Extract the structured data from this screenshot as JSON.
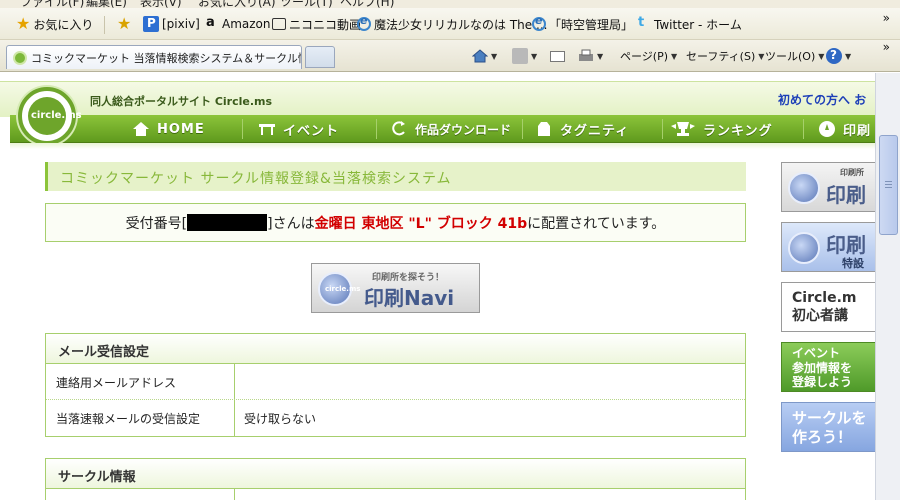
{
  "menubar": {
    "items": [
      "ファイル(F)",
      "編集(E)",
      "表示(V)",
      "お気に入り(A)",
      "ツール(T)",
      "ヘルプ(H)"
    ]
  },
  "favorites_bar": {
    "favorites_label": "お気に入り",
    "links": [
      "[pixiv]",
      "Amazon",
      "ニコニコ動画",
      "魔法少女リリカルなのは The ...",
      "「時空管理局」",
      "Twitter - ホーム"
    ],
    "overflow": "»"
  },
  "tabs": {
    "active_title": "コミックマーケット 当落情報検索システム＆サークル情...",
    "overflow": "»"
  },
  "command_bar": {
    "page_label": "ページ(P)",
    "safety_label": "セーフティ(S)",
    "tools_label": "ツール(O)"
  },
  "site": {
    "tagline": "同人総合ポータルサイト Circle.ms",
    "first_time_link": "初めての方へ お",
    "logo_text": "circle.ms",
    "nav": [
      {
        "label": "HOME",
        "icon": "home-icon"
      },
      {
        "label": "イベント",
        "icon": "table-icon"
      },
      {
        "label": "作品ダウンロード",
        "icon": "download-icon"
      },
      {
        "label": "タグニティ",
        "icon": "tag-icon"
      },
      {
        "label": "ランキング",
        "icon": "trophy-icon"
      },
      {
        "label": "印刷",
        "icon": "compass-icon"
      }
    ]
  },
  "main": {
    "heading": "コミックマーケット サークル情報登録&当落検索システム",
    "notice": {
      "prefix": "受付番号[",
      "suffix_1": "]さんは",
      "placement": "金曜日 東地区 \"L\" ブロック 41b",
      "suffix_2": "に配置されています。"
    },
    "navi_banner": {
      "small": "印刷所を探そう！",
      "big": "印刷Navi",
      "logo": "circle.ms"
    },
    "mail_section": {
      "title": "メール受信設定",
      "rows": [
        {
          "key": "連絡用メールアドレス",
          "value": ""
        },
        {
          "key": "当落速報メールの受信設定",
          "value": "受け取らない"
        }
      ]
    },
    "circle_section": {
      "title": "サークル情報"
    }
  },
  "sidebar": {
    "banners": [
      {
        "small": "印刷所",
        "big": "印刷",
        "sub": ""
      },
      {
        "small": "",
        "big": "印刷",
        "sub": "特設"
      },
      {
        "line1": "Circle.m",
        "line2": "初心者講"
      },
      {
        "line1": "イベント",
        "line2": "参加情報を",
        "line3": "登録しよう"
      },
      {
        "line1": "サークルを",
        "line2": "作ろう！"
      }
    ]
  },
  "colors": {
    "nav_green": "#6ea52b",
    "heading_text": "#88b83a",
    "highlight_red": "#d20000",
    "link_blue": "#1d3fb8"
  }
}
